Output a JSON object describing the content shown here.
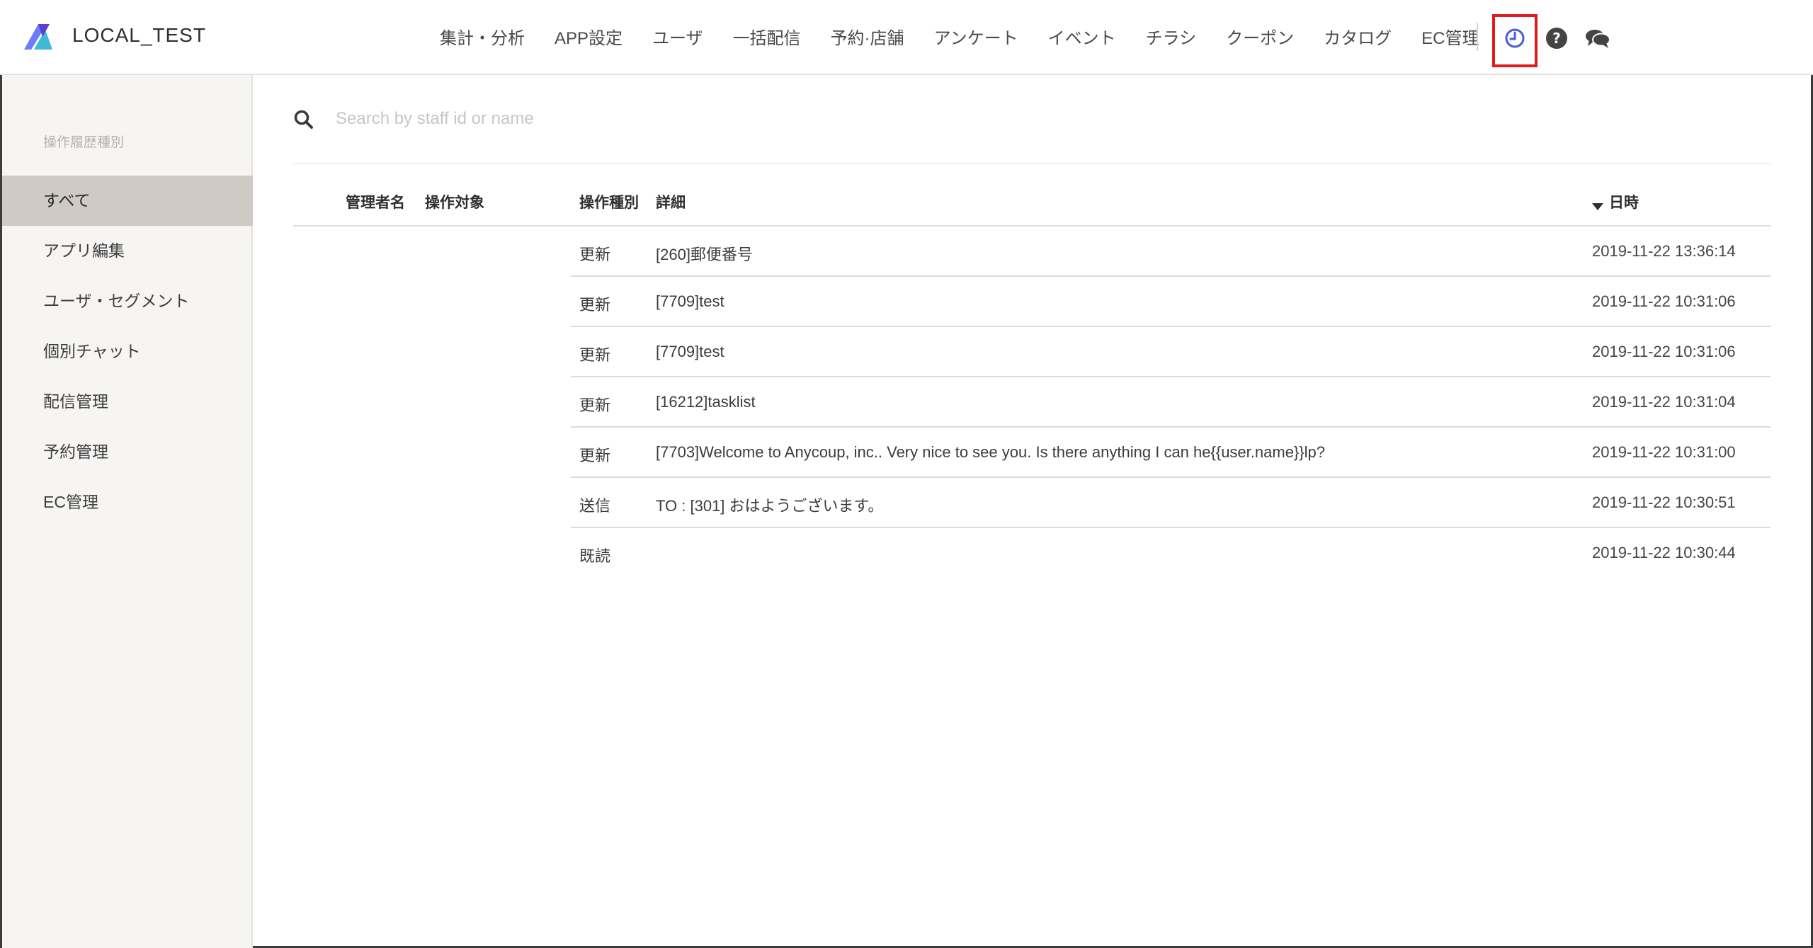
{
  "header": {
    "brand": "LOCAL_TEST",
    "nav": [
      "集計・分析",
      "APP設定",
      "ユーザ",
      "一括配信",
      "予約·店舗",
      "アンケート",
      "イベント",
      "チラシ",
      "クーポン",
      "カタログ",
      "EC管理"
    ],
    "icons": [
      "history-icon",
      "help-icon",
      "chat-icon"
    ],
    "colors": {
      "history_icon": "#4a5bd6",
      "highlight": "#e01b1b"
    }
  },
  "sidebar": {
    "heading": "操作履歴種別",
    "items": [
      "すべて",
      "アプリ編集",
      "ユーザ・セグメント",
      "個別チャット",
      "配信管理",
      "予約管理",
      "EC管理"
    ],
    "active_index": 0
  },
  "search": {
    "placeholder": "Search by staff id or name",
    "value": ""
  },
  "table": {
    "headers": {
      "admin": "管理者名",
      "target": "操作対象",
      "type": "操作種別",
      "detail": "詳細",
      "date": "日時"
    },
    "rows": [
      {
        "type": "更新",
        "detail": "[260]郵便番号",
        "date": "2019-11-22 13:36:14"
      },
      {
        "type": "更新",
        "detail": "[7709]test",
        "date": "2019-11-22 10:31:06"
      },
      {
        "type": "更新",
        "detail": "[7709]test",
        "date": "2019-11-22 10:31:06"
      },
      {
        "type": "更新",
        "detail": "[16212]tasklist",
        "date": "2019-11-22 10:31:04"
      },
      {
        "type": "更新",
        "detail": "[7703]Welcome to Anycoup, inc.. Very nice to see you. Is there anything I can he{{user.name}}lp?",
        "date": "2019-11-22 10:31:00"
      },
      {
        "type": "送信",
        "detail": "TO : [301] おはようございます。",
        "date": "2019-11-22 10:30:51"
      },
      {
        "type": "既読",
        "detail": "",
        "date": "2019-11-22 10:30:44"
      }
    ]
  }
}
